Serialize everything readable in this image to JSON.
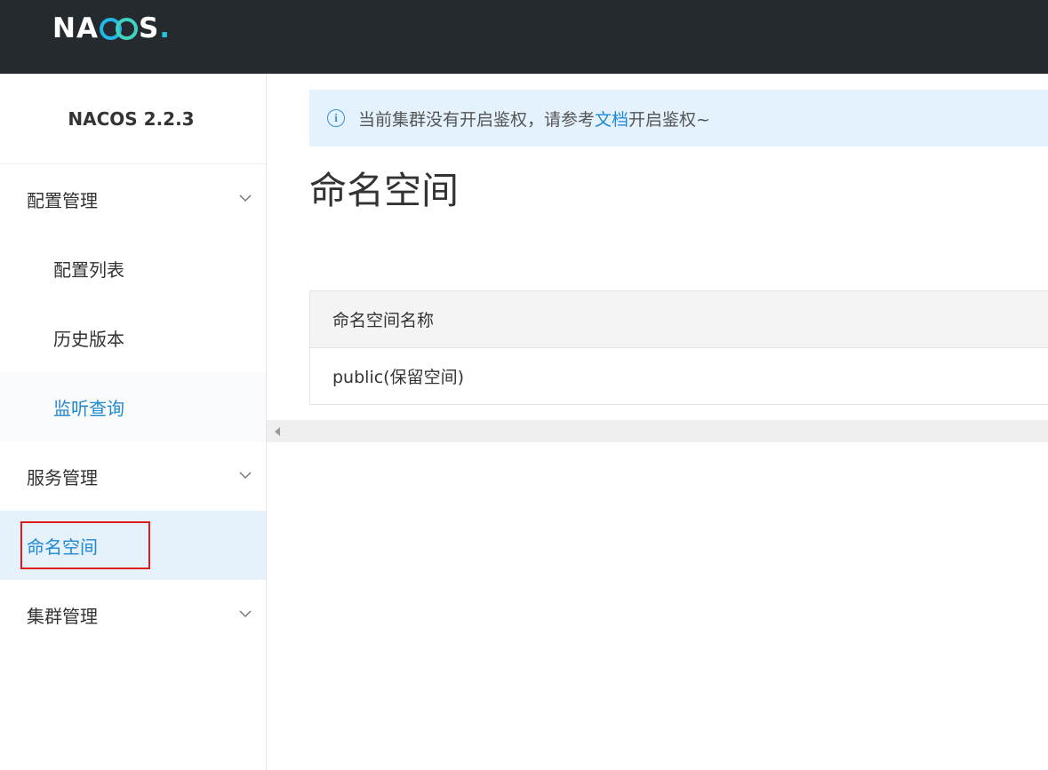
{
  "header": {
    "logo_text_left": "NA",
    "logo_text_right": "S",
    "logo_dot": "."
  },
  "sidebar": {
    "version": "NACOS 2.2.3",
    "groups": [
      {
        "label": "配置管理",
        "icon": "chevron-down-icon"
      },
      {
        "label": "服务管理",
        "icon": "chevron-down-icon"
      },
      {
        "label": "集群管理",
        "icon": "chevron-down-icon"
      }
    ],
    "sub_items": [
      {
        "label": "配置列表"
      },
      {
        "label": "历史版本"
      },
      {
        "label": "监听查询"
      }
    ],
    "selected": {
      "label": "命名空间"
    }
  },
  "notice": {
    "icon": "info-icon",
    "icon_glyph": "i",
    "text_before": "当前集群没有开启鉴权，请参考",
    "link_text": "文档",
    "text_after": "开启鉴权~"
  },
  "main": {
    "title": "命名空间",
    "table": {
      "columns": [
        "命名空间名称"
      ],
      "rows": [
        [
          "public(保留空间)"
        ]
      ]
    }
  },
  "colors": {
    "header_bg": "#252a2f",
    "accent": "#1e88d4",
    "selected_bg": "#e5f2fc",
    "notice_bg": "#e4f2fd",
    "highlight_border": "#e01b1b"
  }
}
